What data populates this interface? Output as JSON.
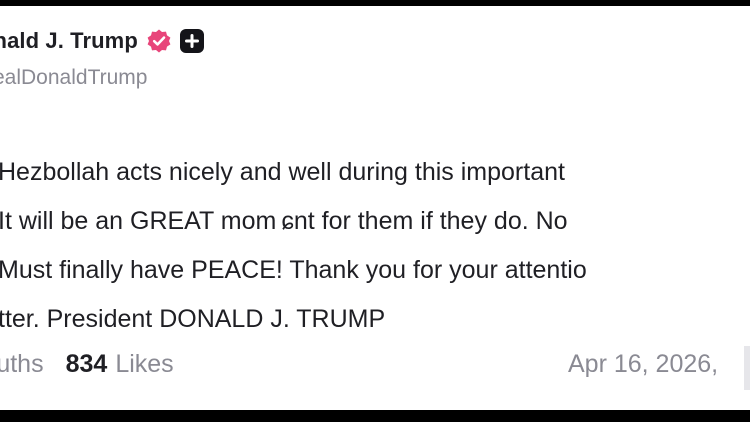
{
  "post": {
    "display_name": "onald J. Trump",
    "handle": "realDonaldTrump",
    "verified_icon": "verified-check-badge",
    "plus_icon": "plus-badge",
    "body_lines": [
      "Hezbollah acts nicely and well during this important",
      " It will be an GREAT mom ɕnt for them if they do. No",
      "Must finally have PEACE! Thank you for your attentio",
      "tter. President DONALD J. TRUMP"
    ],
    "stats": {
      "truths_label": "ruths",
      "likes_count": "834",
      "likes_label": "Likes"
    },
    "timestamp": "Apr 16, 2026,"
  },
  "colors": {
    "badge": "#e8457a",
    "text": "#1f1f24",
    "muted": "#8a8a93",
    "background": "#ffffff"
  }
}
